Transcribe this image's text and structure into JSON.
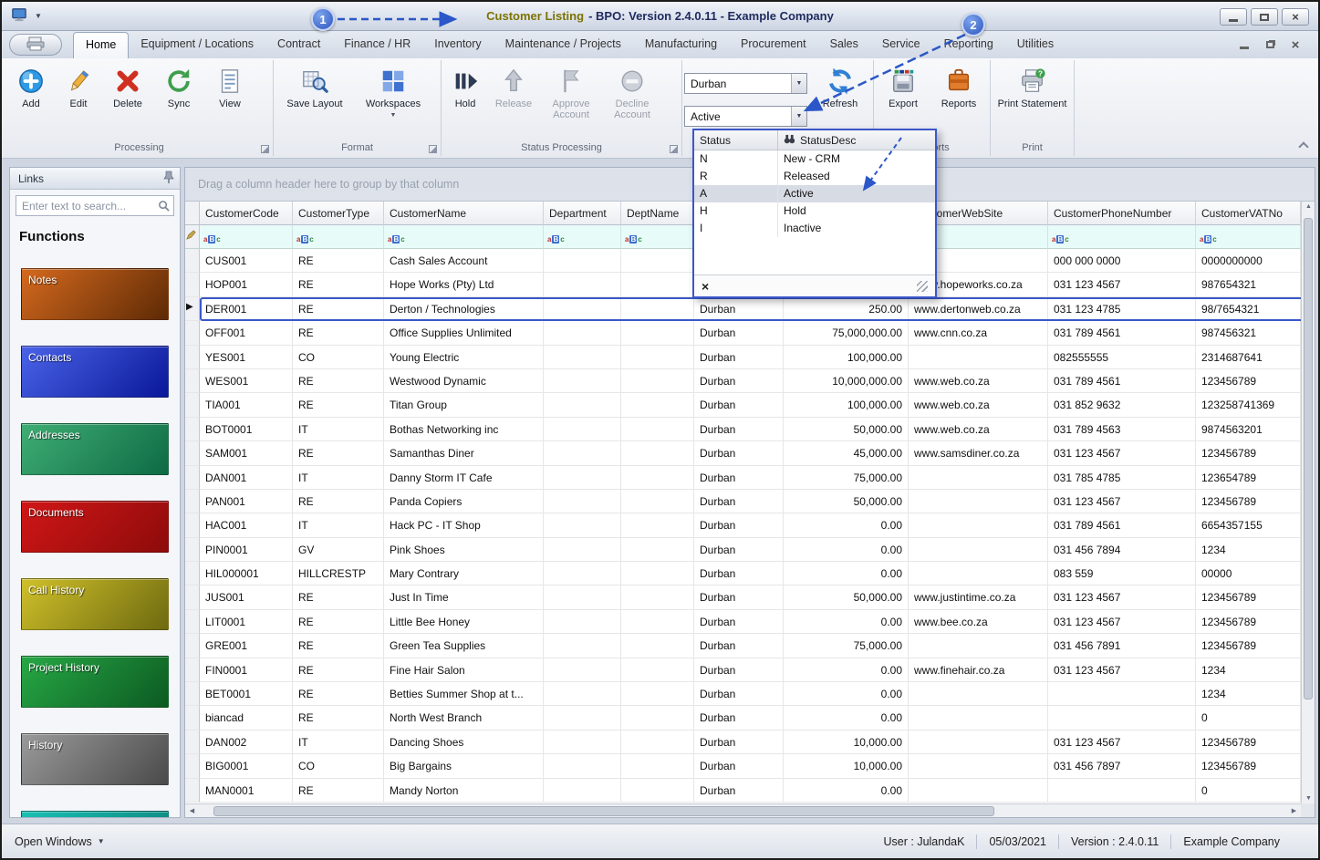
{
  "window": {
    "title_primary": "Customer Listing",
    "title_rest": "- BPO: Version 2.4.0.11 - Example Company"
  },
  "callouts": {
    "one": "1",
    "two": "2"
  },
  "colors": {
    "annotation_blue": "#2b57c8",
    "selection_border": "#3a57c9",
    "filter_row_bg": "#e7fbf9",
    "title_highlight": "#7c7400"
  },
  "tabs": {
    "active": "Home",
    "items": [
      "Home",
      "Equipment / Locations",
      "Contract",
      "Finance / HR",
      "Inventory",
      "Maintenance / Projects",
      "Manufacturing",
      "Procurement",
      "Sales",
      "Service",
      "Reporting",
      "Utilities"
    ]
  },
  "ribbon": {
    "groups": [
      {
        "label": "Processing",
        "buttons": [
          "Add",
          "Edit",
          "Delete",
          "Sync",
          "View"
        ]
      },
      {
        "label": "Format",
        "buttons": [
          "Save Layout",
          "Workspaces"
        ]
      },
      {
        "label": "Status Processing",
        "buttons": [
          "Hold",
          "Release",
          "Approve Account",
          "Decline Account"
        ]
      },
      {
        "label": "",
        "buttons": [
          "Refresh"
        ]
      },
      {
        "label": "Reports",
        "buttons": [
          "Export",
          "Reports"
        ]
      },
      {
        "label": "Print",
        "buttons": [
          "Print Statement"
        ]
      }
    ],
    "site_filter": {
      "value": "Durban"
    },
    "status_filter": {
      "value": "Active"
    }
  },
  "status_dropdown": {
    "col1": "Status",
    "col2": "StatusDesc",
    "clear": "×",
    "options": [
      {
        "code": "N",
        "desc": "New - CRM"
      },
      {
        "code": "R",
        "desc": "Released"
      },
      {
        "code": "A",
        "desc": "Active",
        "selected": true
      },
      {
        "code": "H",
        "desc": "Hold"
      },
      {
        "code": "I",
        "desc": "Inactive"
      }
    ]
  },
  "sidebar": {
    "links_title": "Links",
    "search_placeholder": "Enter text to search...",
    "functions_title": "Functions",
    "functions": [
      {
        "label": "Notes",
        "c1": "#d4691e",
        "c2": "#5e2a05"
      },
      {
        "label": "Contacts",
        "c1": "#4a63e8",
        "c2": "#0a1899"
      },
      {
        "label": "Addresses",
        "c1": "#3fae74",
        "c2": "#0e6a44"
      },
      {
        "label": "Documents",
        "c1": "#d01616",
        "c2": "#8e0b0b"
      },
      {
        "label": "Call History",
        "c1": "#cfc02a",
        "c2": "#6e6a10"
      },
      {
        "label": "Project History",
        "c1": "#27a845",
        "c2": "#0c5a22"
      },
      {
        "label": "History",
        "c1": "#9a9a9a",
        "c2": "#4a4a4a"
      },
      {
        "label": "",
        "c1": "#19c0b4",
        "c2": "#0a8078"
      }
    ]
  },
  "grid": {
    "group_hint": "Drag a column header here to group by that column",
    "columns": [
      "CustomerCode",
      "CustomerType",
      "CustomerName",
      "Department",
      "DeptName",
      "",
      "",
      "CustomerWebSite",
      "CustomerPhoneNumber",
      "CustomerVATNo"
    ],
    "selected_index": 2,
    "rows": [
      [
        "CUS001",
        "RE",
        "Cash Sales Account",
        "",
        "",
        "",
        "",
        "",
        "000 000 0000",
        "0000000000"
      ],
      [
        "HOP001",
        "RE",
        "Hope Works (Pty) Ltd",
        "",
        "",
        "",
        "",
        "www.hopeworks.co.za",
        "031 123 4567",
        "987654321"
      ],
      [
        "DER001",
        "RE",
        "Derton / Technologies",
        "",
        "",
        "Durban",
        "250.00",
        "www.dertonweb.co.za",
        "031 123 4785",
        "98/7654321"
      ],
      [
        "OFF001",
        "RE",
        "Office Supplies Unlimited",
        "",
        "",
        "Durban",
        "75,000,000.00",
        "www.cnn.co.za",
        "031 789 4561",
        "987456321"
      ],
      [
        "YES001",
        "CO",
        "Young Electric",
        "",
        "",
        "Durban",
        "100,000.00",
        "",
        "082555555",
        "2314687641"
      ],
      [
        "WES001",
        "RE",
        "Westwood Dynamic",
        "",
        "",
        "Durban",
        "10,000,000.00",
        "www.web.co.za",
        "031 789 4561",
        "123456789"
      ],
      [
        "TIA001",
        "RE",
        "Titan Group",
        "",
        "",
        "Durban",
        "100,000.00",
        "www.web.co.za",
        "031 852 9632",
        "123258741369"
      ],
      [
        "BOT0001",
        "IT",
        "Bothas Networking inc",
        "",
        "",
        "Durban",
        "50,000.00",
        "www.web.co.za",
        "031 789 4563",
        "9874563201"
      ],
      [
        "SAM001",
        "RE",
        "Samanthas Diner",
        "",
        "",
        "Durban",
        "45,000.00",
        "www.samsdiner.co.za",
        "031 123 4567",
        "123456789"
      ],
      [
        "DAN001",
        "IT",
        "Danny Storm IT Cafe",
        "",
        "",
        "Durban",
        "75,000.00",
        "",
        "031 785 4785",
        "123654789"
      ],
      [
        "PAN001",
        "RE",
        "Panda Copiers",
        "",
        "",
        "Durban",
        "50,000.00",
        "",
        "031 123 4567",
        "123456789"
      ],
      [
        "HAC001",
        "IT",
        "Hack PC - IT Shop",
        "",
        "",
        "Durban",
        "0.00",
        "",
        "031 789 4561",
        "6654357155"
      ],
      [
        "PIN0001",
        "GV",
        "Pink Shoes",
        "",
        "",
        "Durban",
        "0.00",
        "",
        "031 456 7894",
        "1234"
      ],
      [
        "HIL000001",
        "HILLCRESTP",
        "Mary Contrary",
        "",
        "",
        "Durban",
        "0.00",
        "",
        "083 559",
        "00000"
      ],
      [
        "JUS001",
        "RE",
        "Just In Time",
        "",
        "",
        "Durban",
        "50,000.00",
        "www.justintime.co.za",
        "031 123 4567",
        "123456789"
      ],
      [
        "LIT0001",
        "RE",
        "Little Bee Honey",
        "",
        "",
        "Durban",
        "0.00",
        "www.bee.co.za",
        "031 123 4567",
        "123456789"
      ],
      [
        "GRE001",
        "RE",
        "Green Tea Supplies",
        "",
        "",
        "Durban",
        "75,000.00",
        "",
        "031 456 7891",
        "123456789"
      ],
      [
        "FIN0001",
        "RE",
        "Fine Hair Salon",
        "",
        "",
        "Durban",
        "0.00",
        "www.finehair.co.za",
        "031 123 4567",
        "1234"
      ],
      [
        "BET0001",
        "RE",
        "Betties Summer Shop at t...",
        "",
        "",
        "Durban",
        "0.00",
        "",
        "",
        "1234"
      ],
      [
        "biancad",
        "RE",
        "North West Branch",
        "",
        "",
        "Durban",
        "0.00",
        "",
        "",
        "0"
      ],
      [
        "DAN002",
        "IT",
        "Dancing Shoes",
        "",
        "",
        "Durban",
        "10,000.00",
        "",
        "031 123 4567",
        "123456789"
      ],
      [
        "BIG0001",
        "CO",
        "Big Bargains",
        "",
        "",
        "Durban",
        "10,000.00",
        "",
        "031 456 7897",
        "123456789"
      ],
      [
        "MAN0001",
        "RE",
        "Mandy Norton",
        "",
        "",
        "Durban",
        "0.00",
        "",
        "",
        "0"
      ]
    ]
  },
  "statusbar": {
    "open_windows": "Open Windows",
    "user": "User : JulandaK",
    "date": "05/03/2021",
    "version": "Version : 2.4.0.11",
    "company": "Example Company"
  }
}
